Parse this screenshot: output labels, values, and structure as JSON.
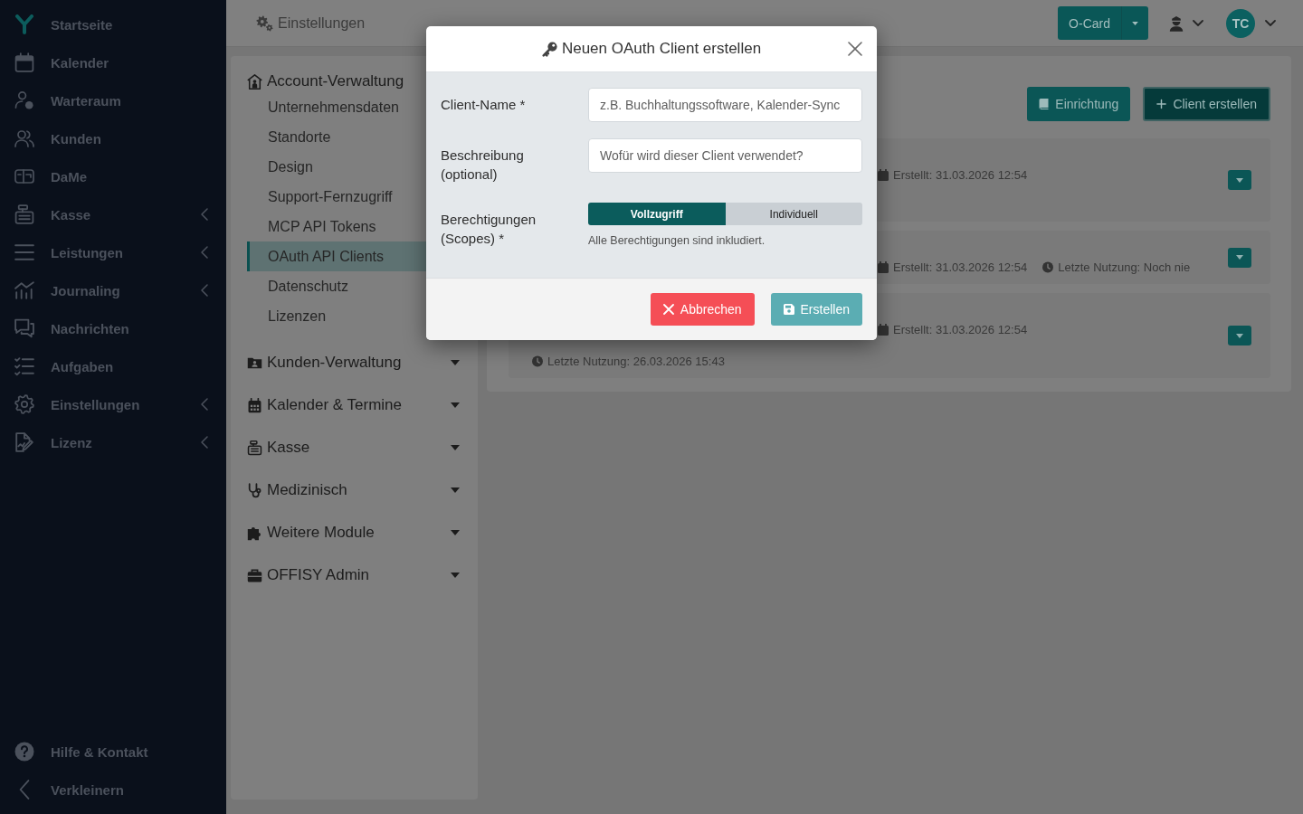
{
  "sidebar": {
    "items": [
      {
        "label": "Startseite",
        "expandable": false
      },
      {
        "label": "Kalender",
        "expandable": false
      },
      {
        "label": "Warteraum",
        "expandable": false
      },
      {
        "label": "Kunden",
        "expandable": false
      },
      {
        "label": "DaMe",
        "expandable": false
      },
      {
        "label": "Kasse",
        "expandable": true
      },
      {
        "label": "Leistungen",
        "expandable": true
      },
      {
        "label": "Journaling",
        "expandable": true
      },
      {
        "label": "Nachrichten",
        "expandable": false
      },
      {
        "label": "Aufgaben",
        "expandable": false
      },
      {
        "label": "Einstellungen",
        "expandable": true
      },
      {
        "label": "Lizenz",
        "expandable": true
      }
    ],
    "footer_items": [
      {
        "label": "Hilfe & Kontakt"
      },
      {
        "label": "Verkleinern"
      }
    ]
  },
  "top_bar": {
    "title": "Einstellungen",
    "switcher": {
      "label": "O-Card"
    },
    "avatar": {
      "initials": "TC"
    }
  },
  "settings_nav": {
    "sections": [
      {
        "label": "Account-Verwaltung",
        "expanded": true,
        "items": [
          {
            "label": "Unternehmensdaten",
            "selected": false
          },
          {
            "label": "Standorte",
            "selected": false
          },
          {
            "label": "Design",
            "selected": false
          },
          {
            "label": "Support-Fernzugriff",
            "selected": false
          },
          {
            "label": "MCP API Tokens",
            "selected": false
          },
          {
            "label": "OAuth API Clients",
            "selected": true
          },
          {
            "label": "Datenschutz",
            "selected": false
          },
          {
            "label": "Lizenzen",
            "selected": false
          }
        ]
      },
      {
        "label": "Kunden-Verwaltung",
        "expanded": false
      },
      {
        "label": "Kalender & Termine",
        "expanded": false
      },
      {
        "label": "Kasse",
        "expanded": false
      },
      {
        "label": "Medizinisch",
        "expanded": false
      },
      {
        "label": "Weitere Module",
        "expanded": false
      },
      {
        "label": "OFFISY Admin",
        "expanded": false
      }
    ]
  },
  "clients_panel": {
    "buttons": [
      {
        "label": "Einrichtung",
        "kind": "guide"
      },
      {
        "label": "Client erstellen",
        "kind": "create"
      }
    ],
    "clients": [
      {
        "rows": [
          {
            "items": [
              {
                "kind": "created",
                "text": "Erstellt: 31.03.2026 12:54"
              }
            ]
          }
        ]
      },
      {
        "rows": [
          {
            "items": [
              {
                "kind": "created",
                "text": "Erstellt: 31.03.2026 12:54"
              },
              {
                "kind": "last_used",
                "text": "Letzte Nutzung: Noch nie"
              }
            ]
          }
        ]
      },
      {
        "rows": [
          {
            "items": [
              {
                "kind": "created",
                "text": "Erstellt: 31.03.2026 12:54"
              }
            ]
          },
          {
            "items": [
              {
                "kind": "last_used",
                "text": "Letzte Nutzung: 26.03.2026 15:43"
              }
            ]
          }
        ]
      }
    ]
  },
  "dialog": {
    "title": "Neuen OAuth Client erstellen",
    "fields": [
      {
        "label": "Client-Name *",
        "placeholder": "z.B. Buchhaltungssoftware, Kalender-Sync"
      },
      {
        "label": "Beschreibung (optional)",
        "placeholder": "Wofür wird dieser Client verwendet?"
      }
    ],
    "scopes": {
      "label": "Berechtigungen (Scopes) *",
      "options": [
        {
          "label": "Vollzugriff",
          "selected": true
        },
        {
          "label": "Individuell",
          "selected": false
        }
      ],
      "hint": "Alle Berechtigungen sind inkludiert."
    },
    "buttons": [
      {
        "label": "Abbrechen",
        "kind": "cancel"
      },
      {
        "label": "Erstellen",
        "kind": "submit"
      }
    ]
  }
}
